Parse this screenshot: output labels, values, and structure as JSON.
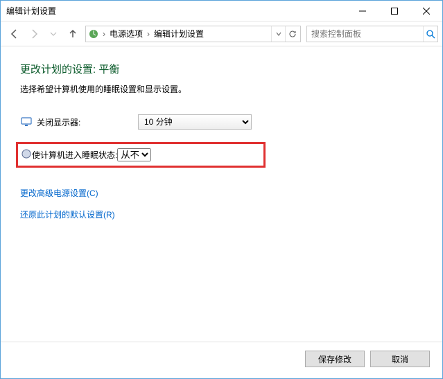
{
  "window": {
    "title": "编辑计划设置"
  },
  "breadcrumb": {
    "items": [
      "电源选项",
      "编辑计划设置"
    ]
  },
  "search": {
    "placeholder": "搜索控制面板"
  },
  "page": {
    "heading": "更改计划的设置: 平衡",
    "subtext": "选择希望计算机使用的睡眠设置和显示设置。"
  },
  "settings": {
    "display_off": {
      "label": "关闭显示器:",
      "value": "10 分钟"
    },
    "sleep": {
      "label": "使计算机进入睡眠状态:",
      "value": "从不"
    }
  },
  "links": {
    "advanced": "更改高级电源设置(C)",
    "restore": "还原此计划的默认设置(R)"
  },
  "buttons": {
    "save": "保存修改",
    "cancel": "取消"
  }
}
